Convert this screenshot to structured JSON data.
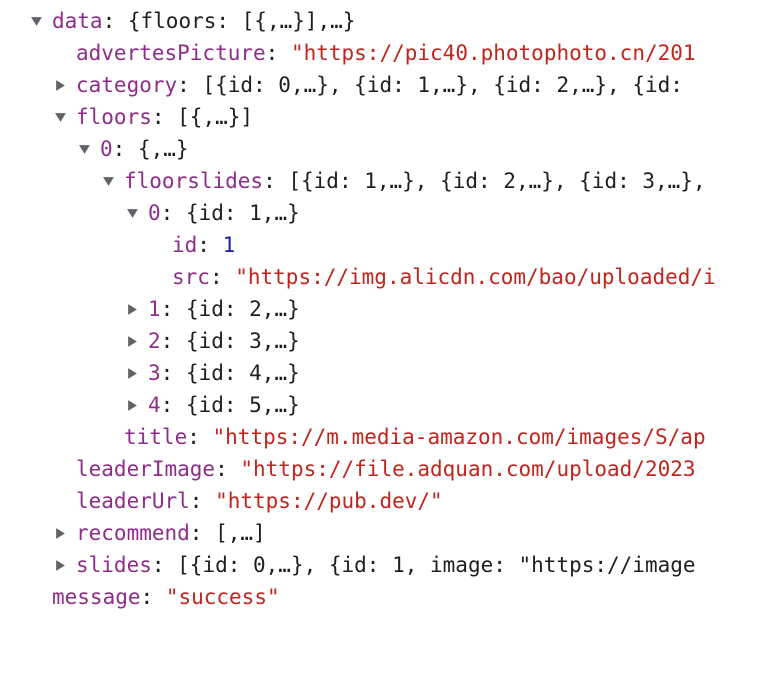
{
  "rows": [
    {
      "depth": 0,
      "toggle": "expanded",
      "key": "data",
      "sep": ": ",
      "value": "{floors: [{,…}],…}",
      "vtype": "preview"
    },
    {
      "depth": 1,
      "toggle": "none",
      "key": "advertesPicture",
      "sep": ": ",
      "value": "\"https://pic40.photophoto.cn/201",
      "vtype": "str"
    },
    {
      "depth": 1,
      "toggle": "collapsed",
      "key": "category",
      "sep": ": ",
      "value": "[{id: 0,…}, {id: 1,…}, {id: 2,…}, {id:",
      "vtype": "preview"
    },
    {
      "depth": 1,
      "toggle": "expanded",
      "key": "floors",
      "sep": ": ",
      "value": "[{,…}]",
      "vtype": "preview"
    },
    {
      "depth": 2,
      "toggle": "expanded",
      "key": "0",
      "sep": ": ",
      "value": "{,…}",
      "vtype": "preview"
    },
    {
      "depth": 3,
      "toggle": "expanded",
      "key": "floorslides",
      "sep": ": ",
      "value": "[{id: 1,…}, {id: 2,…}, {id: 3,…},",
      "vtype": "preview"
    },
    {
      "depth": 4,
      "toggle": "expanded",
      "key": "0",
      "sep": ": ",
      "value": "{id: 1,…}",
      "vtype": "preview"
    },
    {
      "depth": 5,
      "toggle": "none",
      "key": "id",
      "sep": ": ",
      "value": "1",
      "vtype": "num"
    },
    {
      "depth": 5,
      "toggle": "none",
      "key": "src",
      "sep": ": ",
      "value": "\"https://img.alicdn.com/bao/uploaded/i",
      "vtype": "str"
    },
    {
      "depth": 4,
      "toggle": "collapsed",
      "key": "1",
      "sep": ": ",
      "value": "{id: 2,…}",
      "vtype": "preview"
    },
    {
      "depth": 4,
      "toggle": "collapsed",
      "key": "2",
      "sep": ": ",
      "value": "{id: 3,…}",
      "vtype": "preview"
    },
    {
      "depth": 4,
      "toggle": "collapsed",
      "key": "3",
      "sep": ": ",
      "value": "{id: 4,…}",
      "vtype": "preview"
    },
    {
      "depth": 4,
      "toggle": "collapsed",
      "key": "4",
      "sep": ": ",
      "value": "{id: 5,…}",
      "vtype": "preview"
    },
    {
      "depth": 3,
      "toggle": "none",
      "key": "title",
      "sep": ": ",
      "value": "\"https://m.media-amazon.com/images/S/ap",
      "vtype": "str"
    },
    {
      "depth": 1,
      "toggle": "none",
      "key": "leaderImage",
      "sep": ": ",
      "value": "\"https://file.adquan.com/upload/2023",
      "vtype": "str"
    },
    {
      "depth": 1,
      "toggle": "none",
      "key": "leaderUrl",
      "sep": ": ",
      "value": "\"https://pub.dev/\"",
      "vtype": "str"
    },
    {
      "depth": 1,
      "toggle": "collapsed",
      "key": "recommend",
      "sep": ": ",
      "value": "[,…]",
      "vtype": "preview"
    },
    {
      "depth": 1,
      "toggle": "collapsed",
      "key": "slides",
      "sep": ": ",
      "value": "[{id: 0,…}, {id: 1, image: \"https://image",
      "vtype": "preview"
    },
    {
      "depth": 0,
      "toggle": "none",
      "key": "message",
      "sep": ": ",
      "value": "\"success\"",
      "vtype": "str"
    }
  ]
}
